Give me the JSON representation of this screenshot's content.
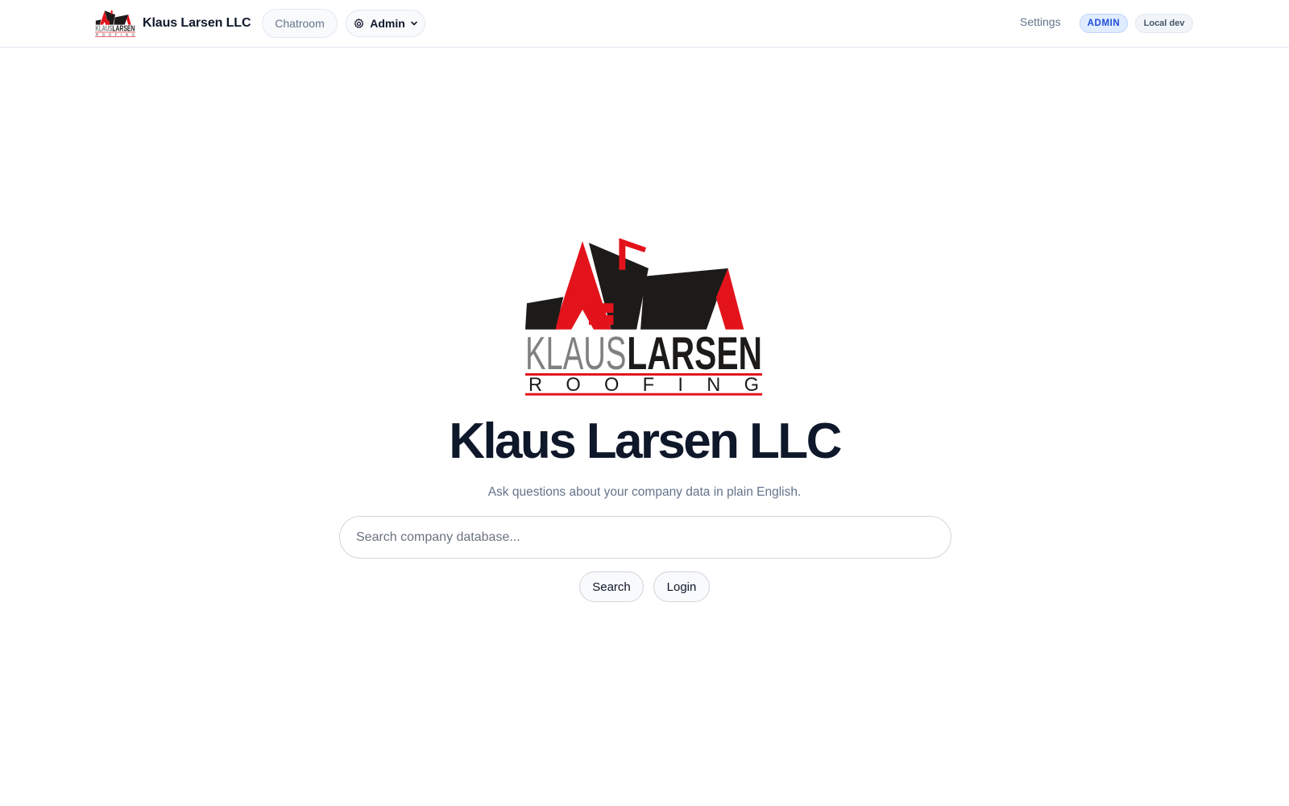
{
  "nav": {
    "brand_name": "Klaus Larsen LLC",
    "chatroom_label": "Chatroom",
    "admin_label": "Admin",
    "settings_label": "Settings",
    "role_badge": "ADMIN",
    "env_badge": "Local dev"
  },
  "logo": {
    "word_left": "KLAUS",
    "word_right": "LARSEN",
    "tagline": "ROOFING"
  },
  "hero": {
    "title": "Klaus Larsen LLC",
    "subtitle": "Ask questions about your company data in plain English.",
    "search_placeholder": "Search company database...",
    "search_value": "",
    "search_button": "Search",
    "login_button": "Login"
  },
  "colors": {
    "brand_red": "#e3131b",
    "brand_black": "#1d1b19",
    "logo_gray": "#808080",
    "accent_blue": "#1d4ed8"
  },
  "icons": {
    "admin": "gear-icon",
    "admin_dropdown": "chevron-down-icon"
  }
}
